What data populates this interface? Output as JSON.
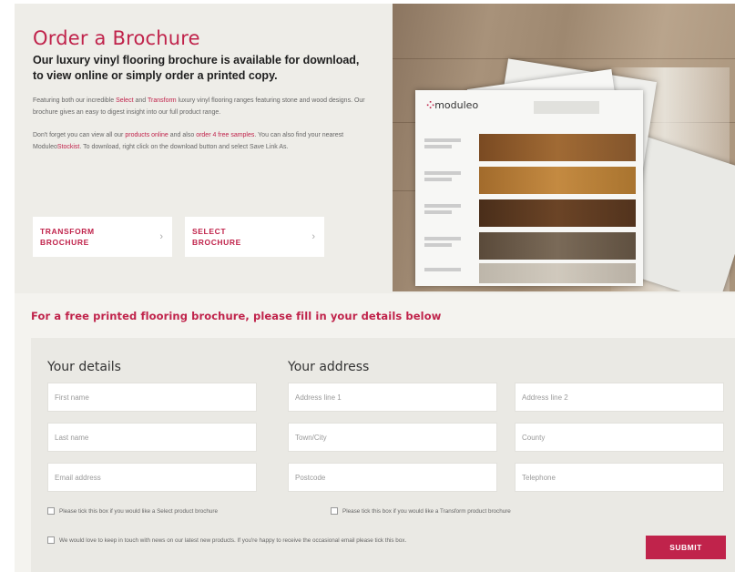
{
  "hero": {
    "title": "Order a Brochure",
    "subtitle": "Our luxury vinyl flooring brochure is available for download, to view online or simply order a printed copy.",
    "para1": {
      "a": "Featuring both our incredible ",
      "select_link": "Select",
      "b": " and ",
      "transform_link": "Transform",
      "c": " luxury vinyl flooring ranges featuring stone and wood designs. Our brochure gives an easy to digest insight into our full product range."
    },
    "para2": {
      "a": "Don't forget you can view all our ",
      "products_link": "products online",
      "b": " and also ",
      "samples_link": "order 4 free samples",
      "c": ". You can also find your nearest Moduleo",
      "stockist_link": "Stockist",
      "d": ". To download, right click on the download button and select Save Link As."
    },
    "buttons": [
      {
        "label": "TRANSFORM\nBROCHURE",
        "icon": "chevron-right-icon"
      },
      {
        "label": "SELECT\nBROCHURE",
        "icon": "chevron-right-icon"
      }
    ],
    "image": {
      "logo_text": "moduleo"
    }
  },
  "form": {
    "heading": "For a free printed flooring brochure, please fill in your details below",
    "details_title": "Your details",
    "address_title": "Your address",
    "placeholders": {
      "first_name": "First name",
      "last_name": "Last name",
      "email": "Email address",
      "address1": "Address line 1",
      "address2": "Address line 2",
      "town": "Town/City",
      "county": "County",
      "postcode": "Postcode",
      "telephone": "Telephone"
    },
    "checkboxes": {
      "select": "Please tick this box if you would like a Select product brochure",
      "transform": "Please tick this box if you would like a Transform product brochure",
      "newsletter": "We would love to keep in touch with news on our latest new products. If you're happy to receive the occasional email please tick this box."
    },
    "submit_label": "SUBMIT"
  },
  "colors": {
    "accent": "#c0234b",
    "hero_bg": "#eeede8",
    "form_bg": "#eae9e4"
  }
}
